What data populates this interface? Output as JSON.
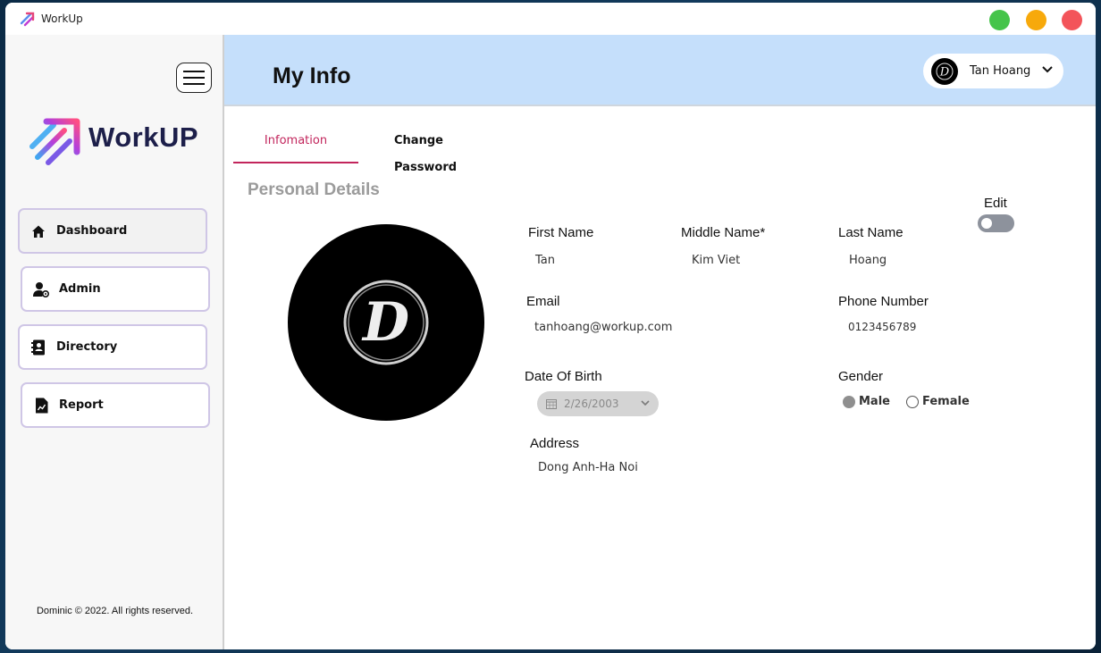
{
  "window": {
    "title": "WorkUp"
  },
  "sidebar": {
    "logo_text": "WorkUP",
    "items": [
      {
        "label": "Dashboard",
        "icon": "home-icon"
      },
      {
        "label": "Admin",
        "icon": "user-gear-icon"
      },
      {
        "label": "Directory",
        "icon": "address-book-icon"
      },
      {
        "label": "Report",
        "icon": "report-chart-icon"
      }
    ],
    "footer": "Dominic © 2022. All rights reserved."
  },
  "header": {
    "title": "My Info",
    "user_name": "Tan Hoang",
    "user_initial": "D"
  },
  "tabs": [
    {
      "label": "Infomation",
      "active": true
    },
    {
      "label": "Change Password",
      "active": false
    }
  ],
  "section_title": "Personal Details",
  "edit": {
    "label": "Edit",
    "enabled": false
  },
  "profile": {
    "avatar_initial": "D"
  },
  "fields": {
    "first_name": {
      "label": "First Name",
      "value": "Tan"
    },
    "middle_name": {
      "label": "Middle Name*",
      "value": "Kim Viet"
    },
    "last_name": {
      "label": "Last Name",
      "value": "Hoang"
    },
    "email": {
      "label": "Email",
      "value": "tanhoang@workup.com"
    },
    "phone": {
      "label": "Phone Number",
      "value": "0123456789"
    },
    "dob": {
      "label": "Date Of Birth",
      "value": "2/26/2003"
    },
    "gender": {
      "label": "Gender",
      "options": [
        "Male",
        "Female"
      ],
      "selected": "Male"
    },
    "address": {
      "label": "Address",
      "value": "Dong Anh-Ha Noi"
    }
  },
  "colors": {
    "accent": "#c2255c",
    "header_bg": "#c5dffb",
    "close": "#f3545a",
    "minimize": "#f7a90b",
    "maximize": "#45c44a"
  }
}
